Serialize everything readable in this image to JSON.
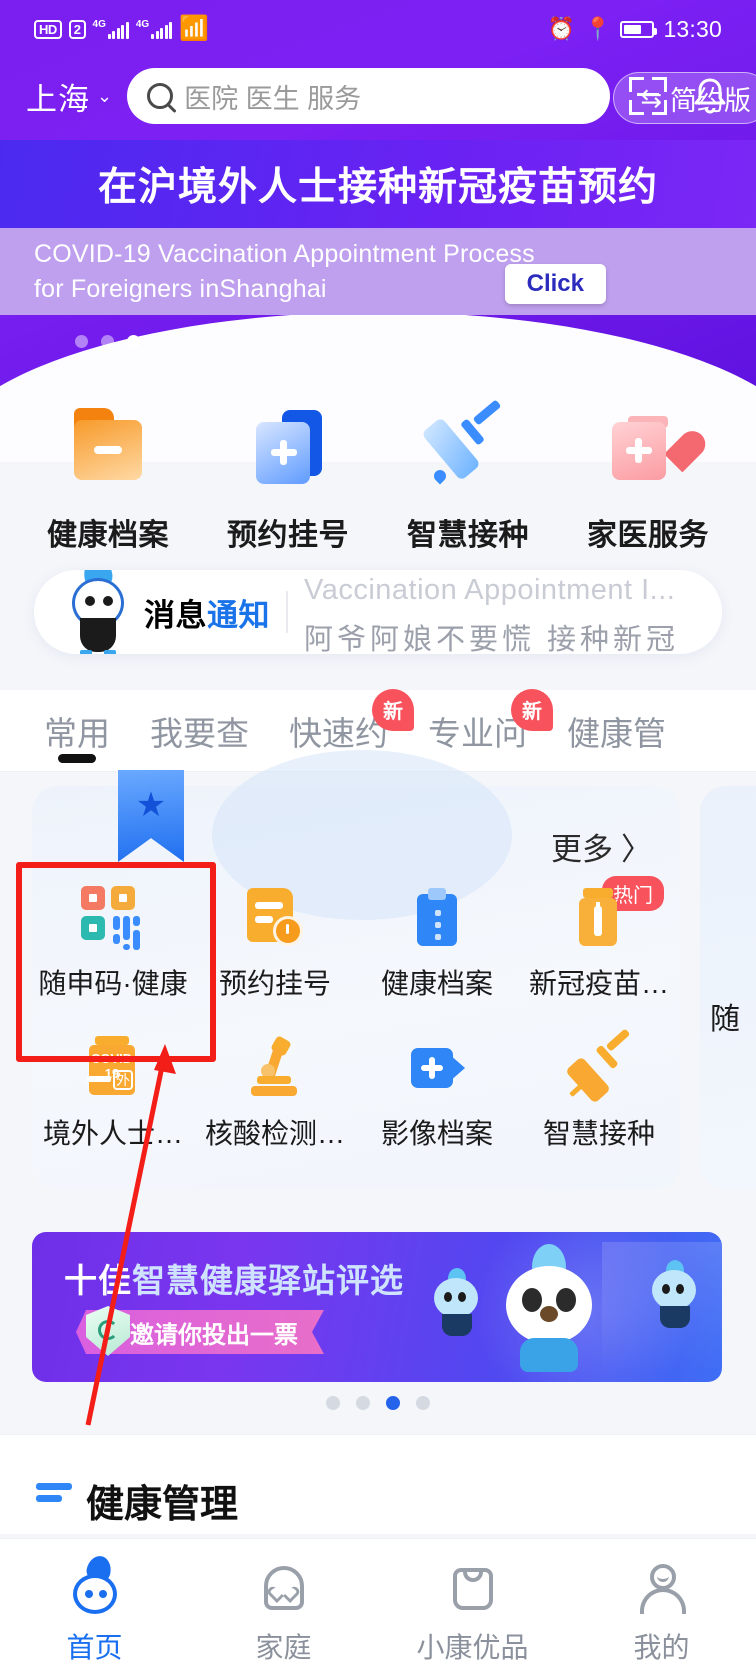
{
  "statusbar": {
    "hd": "HD",
    "sim_badge": "2",
    "net1": "4G",
    "net2": "4G",
    "alarm_icon": "alarm-clock-icon",
    "location_icon": "location-pin-icon",
    "battery_icon": "battery-icon",
    "time": "13:30"
  },
  "header": {
    "city": "上海",
    "chevron": "⌄",
    "search_placeholder": "医院 医生 服务",
    "search_value": "",
    "scan_icon": "scan-code-icon",
    "bell_icon": "notification-bell-icon",
    "simple_mode": "简约版",
    "simple_mode_icon": "swap-arrows-icon"
  },
  "banner": {
    "title_cn": "在沪境外人士接种新冠疫苗预约",
    "subtitle_en_line1": "COVID-19 Vaccination Appointment Process",
    "subtitle_en_line2": "for Foreigners inShanghai",
    "click_label": "Click",
    "dots": [
      false,
      false,
      true
    ]
  },
  "quick_actions": [
    {
      "label": "健康档案",
      "icon": "health-record-folder-icon"
    },
    {
      "label": "预约挂号",
      "icon": "appointment-cards-icon"
    },
    {
      "label": "智慧接种",
      "icon": "syringe-icon"
    },
    {
      "label": "家医服务",
      "icon": "family-doctor-heart-icon"
    }
  ],
  "notice": {
    "mascot_icon": "bird-mascot-icon",
    "title_black": "消息",
    "title_blue": "通知",
    "marquee_line1": "Vaccination Appointment I...",
    "marquee_line2": "阿爷阿娘不要慌  接种新冠"
  },
  "tabs": [
    {
      "label": "常用",
      "active": true,
      "badge": ""
    },
    {
      "label": "我要查",
      "active": false,
      "badge": ""
    },
    {
      "label": "快速约",
      "active": false,
      "badge": "新"
    },
    {
      "label": "专业问",
      "active": false,
      "badge": "新"
    },
    {
      "label": "健康管",
      "active": false,
      "badge": ""
    }
  ],
  "grid_card": {
    "ribbon_icon": "star-bookmark-icon",
    "more_label": "更多",
    "more_chevron": "〉",
    "peek_label": "随",
    "items": [
      {
        "label": "随申码·健康",
        "icon": "qr-health-code-icon",
        "badge": "",
        "highlighted": true
      },
      {
        "label": "预约挂号",
        "icon": "appointment-clock-doc-icon",
        "badge": ""
      },
      {
        "label": "健康档案",
        "icon": "clipboard-record-icon",
        "badge": ""
      },
      {
        "label": "新冠疫苗…",
        "icon": "vaccine-vial-icon",
        "badge": "热门"
      },
      {
        "label": "境外人士…",
        "icon": "covid19-foreigner-vial-icon",
        "badge": ""
      },
      {
        "label": "核酸检测…",
        "icon": "microscope-icon",
        "badge": ""
      },
      {
        "label": "影像档案",
        "icon": "video-plus-icon",
        "badge": ""
      },
      {
        "label": "智慧接种",
        "icon": "syringe-orange-icon",
        "badge": ""
      }
    ]
  },
  "promo": {
    "title_prefix": "十佳",
    "title_rest": "智慧健康驿站评选",
    "pill_label": "邀请你投出一票",
    "shield_icon": "shield-leaf-icon",
    "mascot_icon": "bird-mascot-icon",
    "dots": [
      false,
      false,
      true,
      false
    ]
  },
  "section_peek": {
    "icon": "menu-bars-icon",
    "title": "健康管理"
  },
  "bottom_nav": [
    {
      "label": "首页",
      "icon": "home-bird-icon",
      "active": true
    },
    {
      "label": "家庭",
      "icon": "family-house-heart-icon",
      "active": false
    },
    {
      "label": "小康优品",
      "icon": "shopping-bag-icon",
      "active": false
    },
    {
      "label": "我的",
      "icon": "user-profile-icon",
      "active": false
    }
  ],
  "annotation": {
    "highlight_color": "#f41e19",
    "target": "随申码·健康"
  }
}
